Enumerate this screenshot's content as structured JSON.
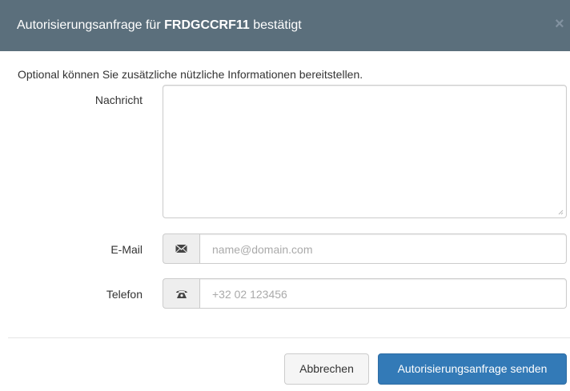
{
  "dialog": {
    "title_prefix": "Autorisierungsanfrage für",
    "title_code": "FRDGCCRF11",
    "title_suffix": "bestätigt",
    "close_symbol": "×"
  },
  "form": {
    "intro": "Optional können Sie zusätzliche nützliche Informationen bereitstellen.",
    "message": {
      "label": "Nachricht",
      "value": ""
    },
    "email": {
      "label": "E-Mail",
      "placeholder": "name@domain.com",
      "icon": "envelope-icon"
    },
    "phone": {
      "label": "Telefon",
      "placeholder": "+32 02 123456",
      "icon": "phone-icon"
    }
  },
  "footer": {
    "cancel_label": "Abbrechen",
    "submit_label": "Autorisierungsanfrage senden"
  },
  "colors": {
    "header_bg": "#5b6f7c",
    "primary": "#337ab7",
    "border": "#cccccc",
    "addon_bg": "#eeeeee"
  }
}
